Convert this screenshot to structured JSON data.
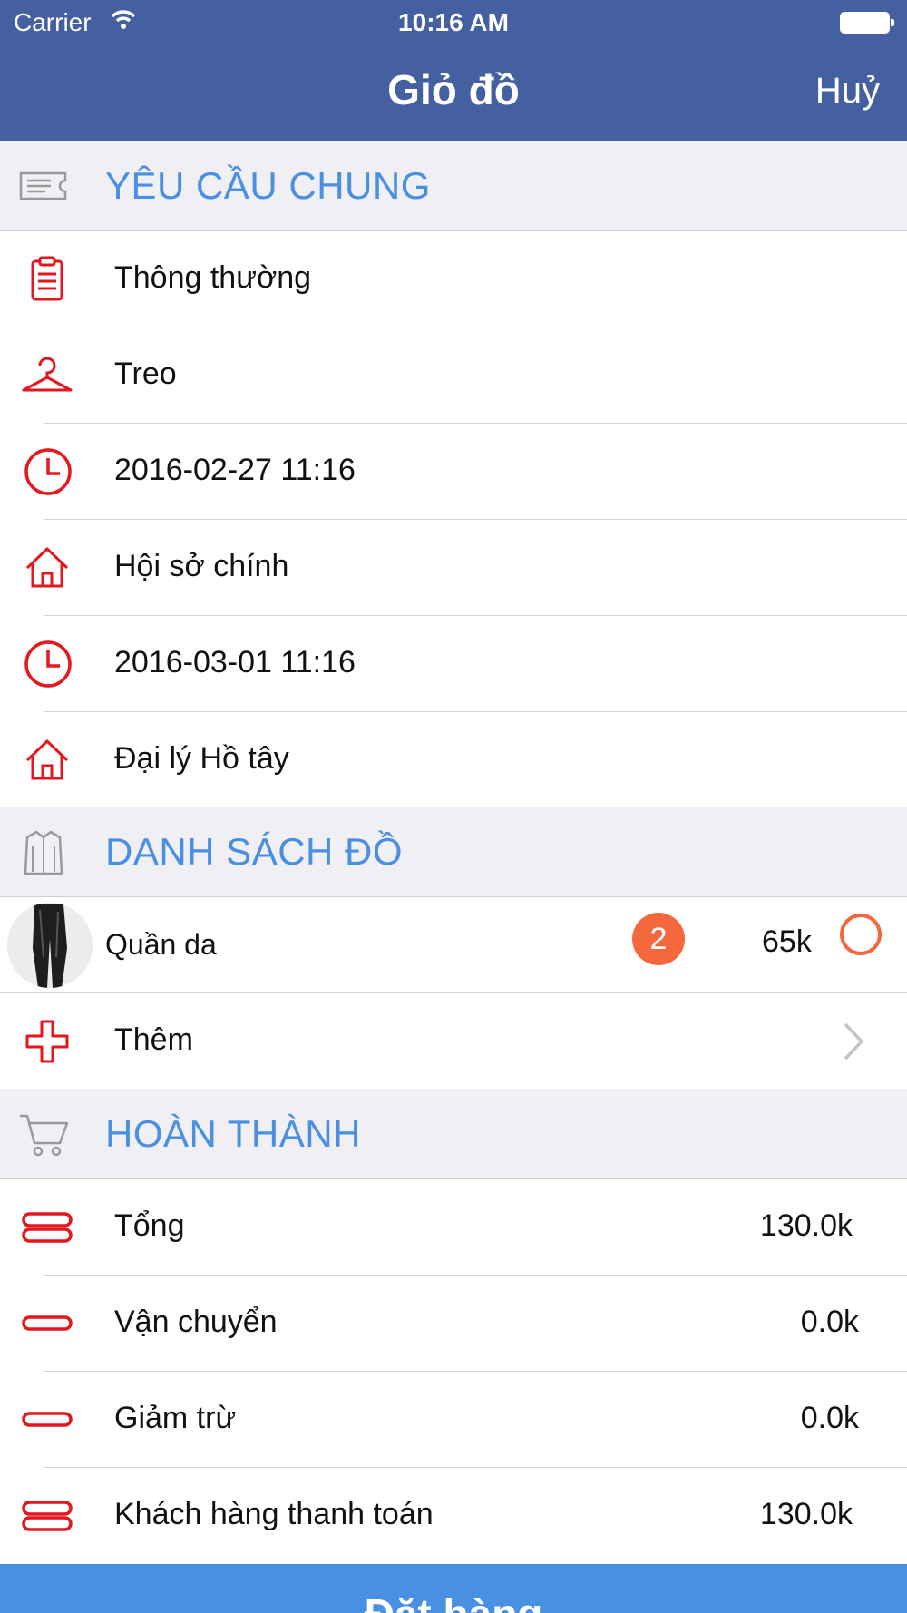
{
  "status_bar": {
    "carrier": "Carrier",
    "time": "10:16 AM"
  },
  "nav": {
    "title": "Giỏ đồ",
    "cancel": "Huỷ"
  },
  "colors": {
    "nav_bg": "#4460a1",
    "section_title": "#4a90e2",
    "icon_red": "#e3171d",
    "badge": "#f5683d",
    "button": "#4a90e2"
  },
  "sections": {
    "general": {
      "title": "YÊU CẦU CHUNG",
      "icon": "ticket-icon",
      "rows": [
        {
          "icon": "clipboard-icon",
          "label": "Thông thường"
        },
        {
          "icon": "hanger-icon",
          "label": "Treo"
        },
        {
          "icon": "clock-icon",
          "label": "2016-02-27 11:16"
        },
        {
          "icon": "home-icon",
          "label": "Hội sở chính"
        },
        {
          "icon": "clock-icon",
          "label": "2016-03-01 11:16"
        },
        {
          "icon": "home-icon",
          "label": "Đại lý Hồ tây"
        }
      ]
    },
    "items": {
      "title": "DANH SÁCH ĐỒ",
      "icon": "shirt-icon",
      "list": [
        {
          "name": "Quần da",
          "quantity": "2",
          "price": "65k",
          "thumb": "leather-pants-thumbnail"
        }
      ],
      "add_label": "Thêm"
    },
    "complete": {
      "title": "HOÀN THÀNH",
      "icon": "cart-icon",
      "rows": [
        {
          "icon": "double-bar-icon",
          "label": "Tổng",
          "value": "130.0k"
        },
        {
          "icon": "single-bar-icon",
          "label": "Vận chuyển",
          "value": "0.0k"
        },
        {
          "icon": "single-bar-icon",
          "label": "Giảm trừ",
          "value": "0.0k"
        },
        {
          "icon": "double-bar-icon",
          "label": "Khách hàng thanh toán",
          "value": "130.0k"
        }
      ]
    }
  },
  "order_button": "Đặt hàng"
}
